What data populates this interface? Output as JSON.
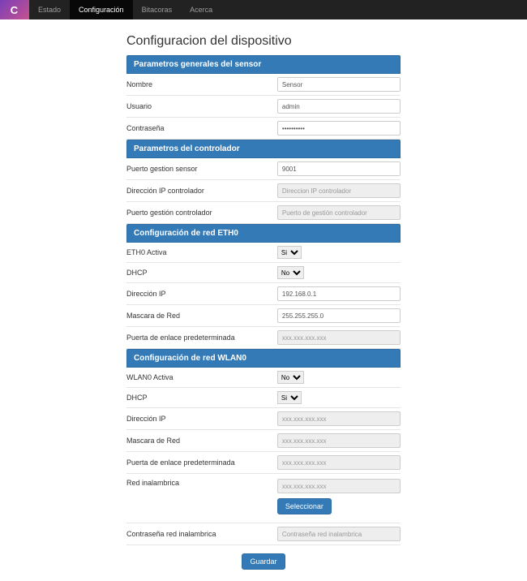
{
  "nav": {
    "logo": "C",
    "items": [
      {
        "label": "Estado",
        "active": false
      },
      {
        "label": "Configuración",
        "active": true
      },
      {
        "label": "Bitacoras",
        "active": false
      },
      {
        "label": "Acerca",
        "active": false
      }
    ]
  },
  "page_title": "Configuracion del dispositivo",
  "sections": {
    "general": {
      "heading": "Parametros generales del sensor",
      "name_label": "Nombre",
      "name_value": "Sensor",
      "user_label": "Usuario",
      "user_value": "admin",
      "pass_label": "Contraseña",
      "pass_value": "••••••••••"
    },
    "controller": {
      "heading": "Parametros del controlador",
      "port_label": "Puerto gestion sensor",
      "port_value": "9001",
      "ip_label": "Dirección IP controlador",
      "ip_placeholder": "Direccion IP controlador",
      "mgmt_port_label": "Puerto gestión controlador",
      "mgmt_port_placeholder": "Puerto de gestión controlador"
    },
    "eth0": {
      "heading": "Configuración de red ETH0",
      "active_label": "ETH0 Activa",
      "active_value": "Si",
      "dhcp_label": "DHCP",
      "dhcp_value": "No",
      "ip_label": "Dirección IP",
      "ip_value": "192.168.0.1",
      "mask_label": "Mascara de Red",
      "mask_value": "255.255.255.0",
      "gateway_label": "Puerta de enlace predeterminada",
      "gateway_placeholder": "xxx.xxx.xxx.xxx"
    },
    "wlan0": {
      "heading": "Configuración de red WLAN0",
      "active_label": "WLAN0 Activa",
      "active_value": "No",
      "dhcp_label": "DHCP",
      "dhcp_value": "Si",
      "ip_label": "Dirección IP",
      "ip_placeholder": "xxx.xxx.xxx.xxx",
      "mask_label": "Mascara de Red",
      "mask_placeholder": "xxx.xxx.xxx.xxx",
      "gateway_label": "Puerta de enlace predeterminada",
      "gateway_placeholder": "xxx.xxx.xxx.xxx",
      "ssid_label": "Red inalambrica",
      "ssid_placeholder": "xxx.xxx.xxx.xxx",
      "select_button": "Seleccionar",
      "wifi_pass_label": "Contraseña red inalambrica",
      "wifi_pass_placeholder": "Contraseña red inalambrica"
    }
  },
  "save_button": "Guardar"
}
